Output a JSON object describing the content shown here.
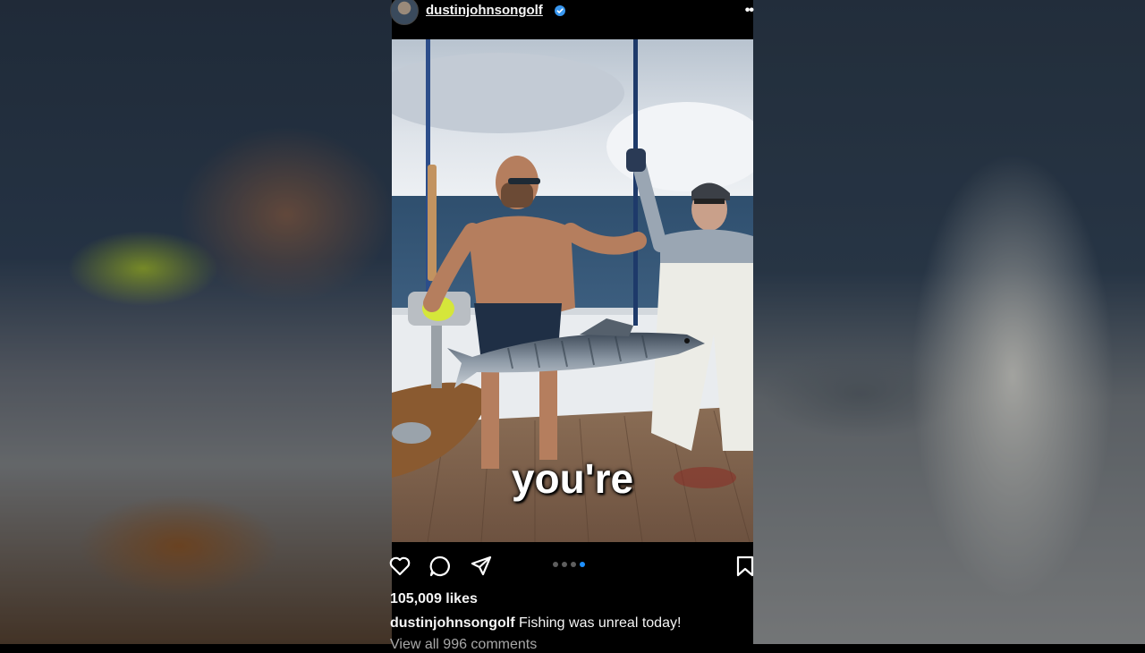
{
  "post": {
    "username": "dustinjohnsongolf",
    "verified": true,
    "likes": "105,009 likes",
    "caption": {
      "user": "dustinjohnsongolf",
      "text": "Fishing was unreal today!"
    },
    "comments_preview": "View all 996 comments",
    "carousel": {
      "total": 4,
      "active_index": 3
    },
    "overlay_word": "you're"
  },
  "icons": {
    "more": "more-options-icon",
    "like": "heart-icon",
    "comment": "comment-icon",
    "share": "share-icon",
    "save": "bookmark-icon",
    "verified": "verified-badge-icon"
  },
  "colors": {
    "accent": "#1e90ff",
    "background": "#000000",
    "text": "#f5f5f5"
  }
}
